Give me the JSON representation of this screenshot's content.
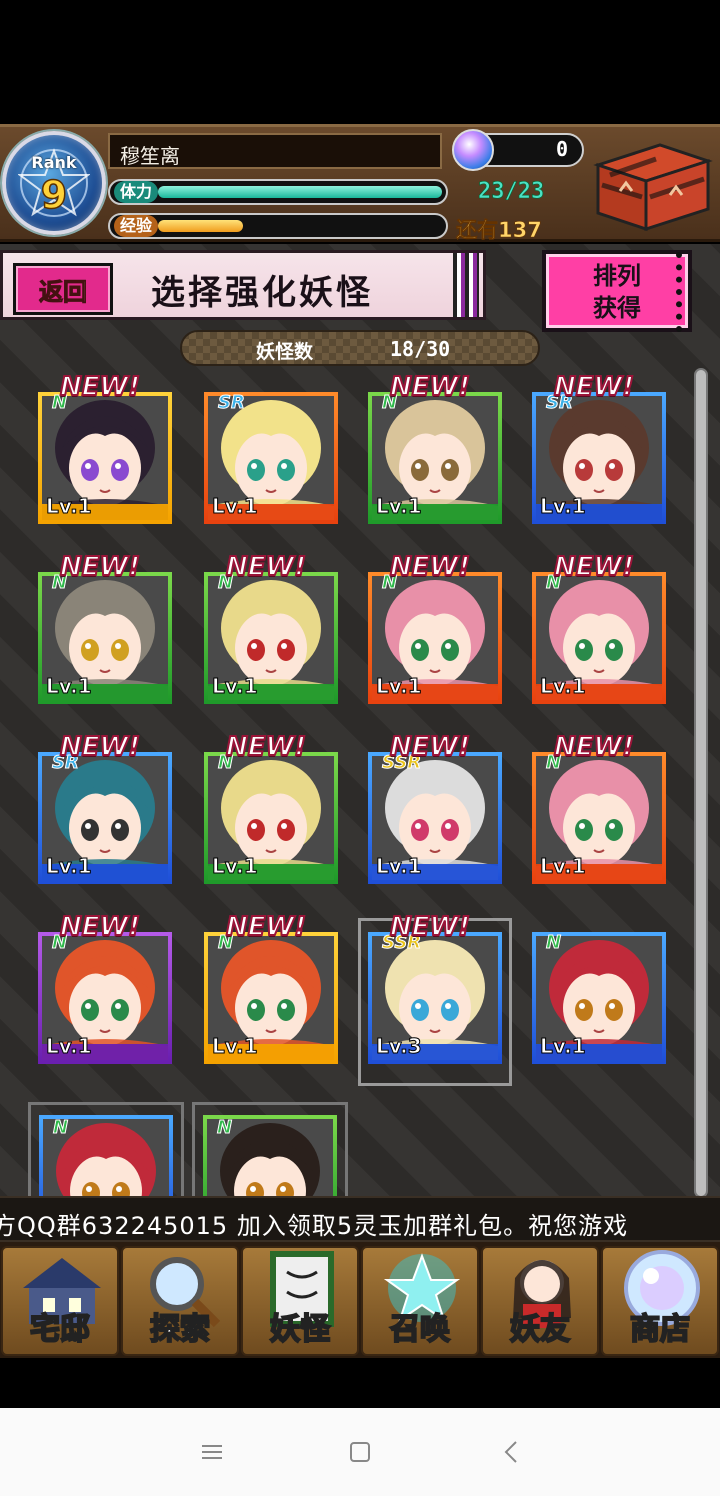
{
  "player": {
    "rank_label": "Rank",
    "rank_value": "9",
    "name": "穆笙离",
    "stamina_label": "体力",
    "stamina_value": "23/23",
    "stamina_fraction": 1.0,
    "exp_label": "经验",
    "exp_value": "还有137",
    "exp_fraction": 0.3,
    "orbs": "0"
  },
  "header": {
    "back_label": "返回",
    "title": "选择强化妖怪",
    "sort_line1": "排列",
    "sort_line2": "获得"
  },
  "counter": {
    "label": "妖怪数",
    "value": "18/30"
  },
  "cards": [
    {
      "rarity": "N",
      "level": "Lv.1",
      "new": "NEW!",
      "frame": "yellow",
      "hair": "#2b2030",
      "eye": "#8a4ad0"
    },
    {
      "rarity": "SR",
      "level": "Lv.1",
      "new": "",
      "frame": "orange",
      "hair": "#f2e28a",
      "eye": "#2aa08a"
    },
    {
      "rarity": "N",
      "level": "Lv.1",
      "new": "NEW!",
      "frame": "green",
      "hair": "#d9c49a",
      "eye": "#8a6a3a"
    },
    {
      "rarity": "SR",
      "level": "Lv.1",
      "new": "NEW!",
      "frame": "blue",
      "hair": "#5a3a2e",
      "eye": "#b83a3a"
    },
    {
      "rarity": "N",
      "level": "Lv.1",
      "new": "NEW!",
      "frame": "green",
      "hair": "#8a8478",
      "eye": "#d0a020"
    },
    {
      "rarity": "N",
      "level": "Lv.1",
      "new": "NEW!",
      "frame": "green",
      "hair": "#e8d98a",
      "eye": "#c02a2a"
    },
    {
      "rarity": "N",
      "level": "Lv.1",
      "new": "NEW!",
      "frame": "orange",
      "hair": "#e890a8",
      "eye": "#2a8a4a"
    },
    {
      "rarity": "N",
      "level": "Lv.1",
      "new": "NEW!",
      "frame": "orange",
      "hair": "#e890a8",
      "eye": "#2a8a4a"
    },
    {
      "rarity": "SR",
      "level": "Lv.1",
      "new": "NEW!",
      "frame": "blue",
      "hair": "#2a7a8a",
      "eye": "#333"
    },
    {
      "rarity": "N",
      "level": "Lv.1",
      "new": "NEW!",
      "frame": "green",
      "hair": "#e8d98a",
      "eye": "#c02a2a"
    },
    {
      "rarity": "SSR",
      "level": "Lv.1",
      "new": "NEW!",
      "frame": "blue",
      "hair": "#dcdcdc",
      "eye": "#d03a6a"
    },
    {
      "rarity": "N",
      "level": "Lv.1",
      "new": "NEW!",
      "frame": "orange",
      "hair": "#e890a8",
      "eye": "#2a8a4a"
    },
    {
      "rarity": "N",
      "level": "Lv.1",
      "new": "NEW!",
      "frame": "purple",
      "hair": "#e0552a",
      "eye": "#2a8a4a"
    },
    {
      "rarity": "N",
      "level": "Lv.1",
      "new": "NEW!",
      "frame": "yellow",
      "hair": "#e0552a",
      "eye": "#2a8a4a"
    },
    {
      "rarity": "SSR",
      "level": "Lv.3",
      "new": "NEW!",
      "frame": "blue",
      "hair": "#efe2b0",
      "eye": "#3aa8d8",
      "selected": true
    },
    {
      "rarity": "N",
      "level": "Lv.1",
      "new": "",
      "frame": "blue",
      "hair": "#c02a3a",
      "eye": "#c07a1a"
    }
  ],
  "partial_cards": [
    {
      "rarity": "N",
      "frame": "blue",
      "hair": "#c02a3a"
    },
    {
      "rarity": "N",
      "frame": "green",
      "hair": "#2a201c"
    }
  ],
  "ticker": "方QQ群632245015    加入领取5灵玉加群礼包。祝您游戏",
  "nav": [
    {
      "label": "宅邸",
      "icon": "mansion-icon"
    },
    {
      "label": "探索",
      "icon": "magnifier-icon"
    },
    {
      "label": "妖怪",
      "icon": "scroll-icon"
    },
    {
      "label": "召唤",
      "icon": "pentagram-icon"
    },
    {
      "label": "妖友",
      "icon": "friend-icon"
    },
    {
      "label": "商店",
      "icon": "shop-orb-icon"
    }
  ],
  "colors": {
    "yellow": [
      "#ffd23a",
      "#f5a300"
    ],
    "orange": [
      "#ff8a2a",
      "#e8420f"
    ],
    "green": [
      "#7ad84a",
      "#1f9a2a"
    ],
    "blue": [
      "#4aa8ff",
      "#1f4fd8"
    ],
    "purple": [
      "#b45ae8",
      "#6a1fb0"
    ],
    "rarity_N": "#2fb84a",
    "rarity_SR": "#3ab0e8",
    "rarity_SSR": "#e8c21a"
  }
}
